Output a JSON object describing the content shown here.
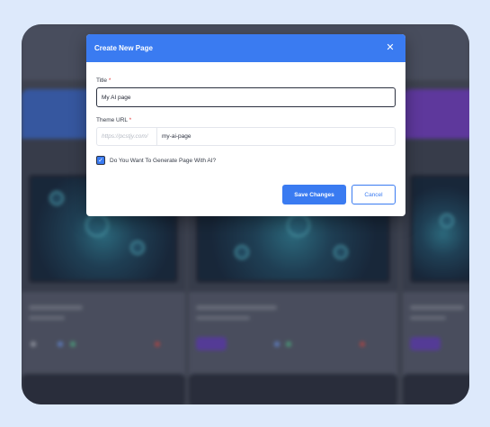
{
  "modal": {
    "title": "Create New Page",
    "close_icon": "close-icon",
    "title_label": "Title",
    "title_value": "My AI page",
    "theme_url_label": "Theme URL",
    "required_mark": "*",
    "url_prefix": "https://pcstjy.com/",
    "url_value": "my-ai-page",
    "checkbox_label": "Do You Want To Generate Page With AI?",
    "checkbox_checked": true,
    "save_label": "Save Changes",
    "cancel_label": "Cancel"
  },
  "colors": {
    "accent": "#3a7bf1",
    "page_bg": "#dde9fb",
    "required": "#e03a3a"
  }
}
